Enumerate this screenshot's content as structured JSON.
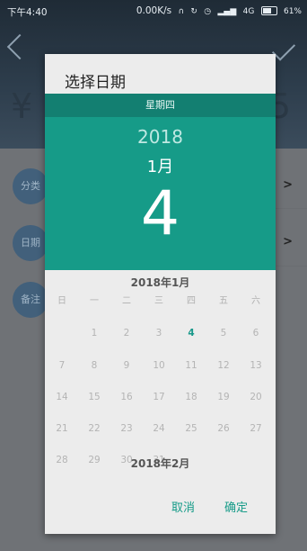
{
  "status": {
    "time": "下午4:40",
    "speed": "0.00K/s",
    "network": "4G",
    "battery": "61%"
  },
  "background": {
    "amount_left": "¥",
    "amount_right": "5",
    "rows": [
      "分类",
      "日期",
      "备注"
    ]
  },
  "dialog": {
    "title": "选择日期",
    "weekday": "星期四",
    "year": "2018",
    "month": "1月",
    "day": "4",
    "calendar_title": "2018年1月",
    "weekday_headers": [
      "日",
      "一",
      "二",
      "三",
      "四",
      "五",
      "六"
    ],
    "weeks": [
      [
        "",
        "1",
        "2",
        "3",
        "4",
        "5",
        "6"
      ],
      [
        "7",
        "8",
        "9",
        "10",
        "11",
        "12",
        "13"
      ],
      [
        "14",
        "15",
        "16",
        "17",
        "18",
        "19",
        "20"
      ],
      [
        "21",
        "22",
        "23",
        "24",
        "25",
        "26",
        "27"
      ],
      [
        "28",
        "29",
        "30",
        "31",
        "",
        "",
        ""
      ]
    ],
    "selected_day": "4",
    "next_month_title": "2018年2月",
    "cancel_label": "取消",
    "ok_label": "确定"
  }
}
